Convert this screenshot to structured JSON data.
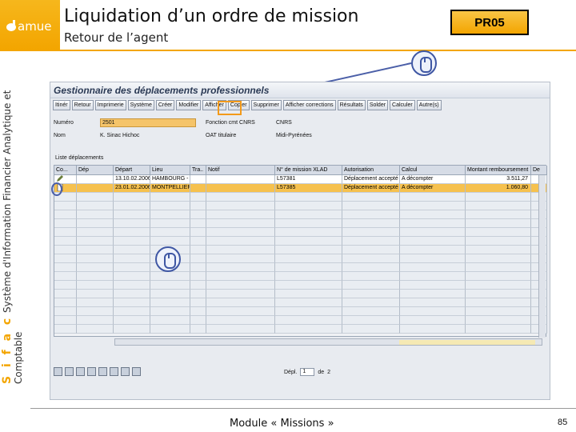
{
  "header": {
    "logo_text": "amue",
    "title": "Liquidation d’un ordre de mission",
    "subtitle": "Retour de l’agent",
    "code": "PR05"
  },
  "side_label": {
    "brand": "S i f a c",
    "text": "Système d'Information Financier Analytique et Comptable"
  },
  "sap": {
    "title": "Gestionnaire des déplacements professionnels",
    "toolbar": [
      "Itinér",
      "Retour",
      "Imprimerie",
      "Système",
      "Créer",
      "Modifier",
      "Afficher",
      "Copier",
      "Supprimer",
      "Afficher corrections",
      "Résultats",
      "Solder",
      "Calculer",
      "Autre(s)"
    ],
    "fields": {
      "numero_label": "Numéro",
      "numero_value": "2501",
      "nom_label": "Nom",
      "nom_value": "K. Sinac Hichoc",
      "fonction_label": "Fonction cmt CNRS",
      "fonction_value": "CNRS",
      "titulaire_label": "OAT titulaire",
      "titulaire_value": "Midi-Pyrénées"
    },
    "list_title": "Liste déplacements",
    "columns": [
      "Co...",
      "Dép",
      "Départ",
      "Lieu",
      "Tra..",
      "Notif",
      "N° de mission XLAD",
      "Autorisation",
      "Calcul",
      "Montant remboursement",
      "De"
    ],
    "rows": [
      [
        "",
        "",
        "13.10.02.2006",
        "HAMBOURG - DES",
        "",
        "",
        "L57381",
        "Déplacement accepté",
        "A décompter",
        "3.511,27",
        ""
      ],
      [
        "",
        "",
        "23.01.02.2006",
        "MONTPELLIER - FR",
        "",
        "",
        "L57385",
        "Déplacement accepté",
        "A décompter",
        "1.060,80",
        ""
      ]
    ],
    "page_label": "Dépl.",
    "page_value": "1",
    "page_of": "de",
    "page_total": "2"
  },
  "footer": {
    "text": "Module « Missions »",
    "page": "85"
  },
  "colors": {
    "accent": "#f3a500",
    "highlight_orange": "#f39a1a",
    "pointer_blue": "#3f57a4"
  }
}
